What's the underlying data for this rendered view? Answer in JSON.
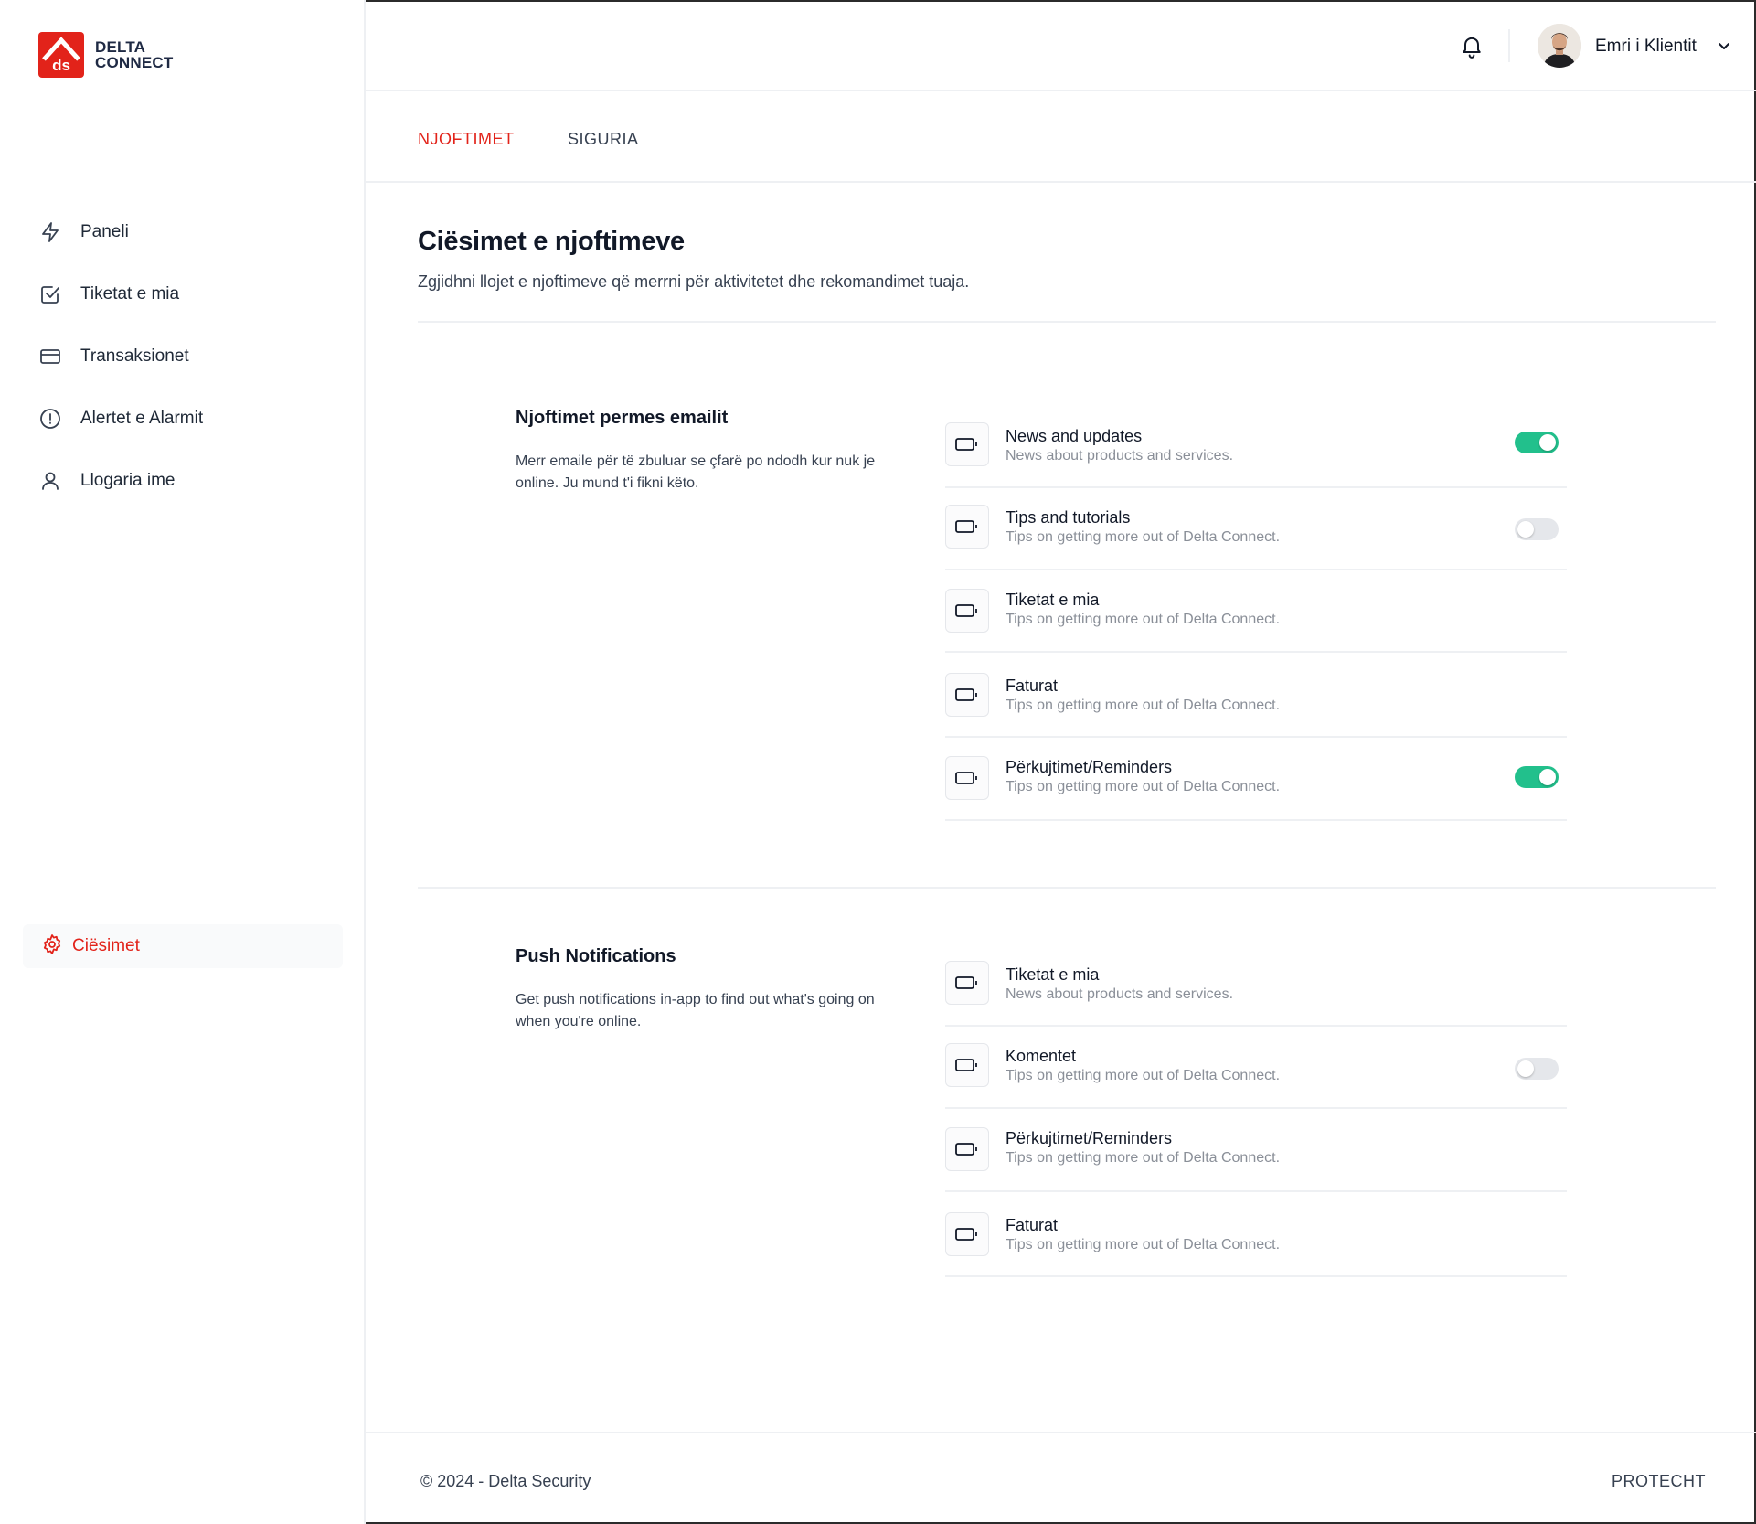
{
  "brand": {
    "line1": "DELTA",
    "line2": "CONNECT",
    "mark": "ds",
    "color": "#e2231a"
  },
  "sidebar": {
    "items": [
      {
        "label": "Paneli",
        "icon": "lightning-icon"
      },
      {
        "label": "Tiketat e mia",
        "icon": "checkbox-icon"
      },
      {
        "label": "Transaksionet",
        "icon": "credit-card-icon"
      },
      {
        "label": "Alertet e Alarmit",
        "icon": "alert-circle-icon"
      },
      {
        "label": "Llogaria ime",
        "icon": "user-icon"
      }
    ],
    "settings": {
      "label": "Ciësimet",
      "icon": "gear-icon"
    }
  },
  "header": {
    "user_name": "Emri i Klientit"
  },
  "tabs": [
    {
      "label": "NJOFTIMET",
      "active": true
    },
    {
      "label": "SIGURIA",
      "active": false
    }
  ],
  "main": {
    "title": "Ciësimet e njoftimeve",
    "subtitle": "Zgjidhni llojet e njoftimeve që merrni për aktivitetet dhe rekomandimet tuaja."
  },
  "sections": {
    "email": {
      "title": "Njoftimet permes emailit",
      "description": "Merr emaile për të zbuluar se çfarë po ndodh kur nuk je online. Ju mund t'i fikni këto.",
      "rows": [
        {
          "title": "News and updates",
          "description": "News about products and services.",
          "toggle": "on"
        },
        {
          "title": "Tips and tutorials",
          "description": "Tips on getting more out of Delta Connect.",
          "toggle": "off"
        },
        {
          "title": "Tiketat e mia",
          "description": "Tips on getting more out of Delta Connect.",
          "toggle": "none"
        },
        {
          "title": "Faturat",
          "description": "Tips on getting more out of Delta Connect.",
          "toggle": "none"
        },
        {
          "title": "Përkujtimet/Reminders",
          "description": "Tips on getting more out of Delta Connect.",
          "toggle": "on"
        }
      ]
    },
    "push": {
      "title": "Push Notifications",
      "description": "Get push notifications in-app to find out what's going on when you're online.",
      "rows": [
        {
          "title": "Tiketat e mia",
          "description": "News about products and services.",
          "toggle": "none"
        },
        {
          "title": "Komentet",
          "description": "Tips on getting more out of Delta Connect.",
          "toggle": "off"
        },
        {
          "title": "Përkujtimet/Reminders",
          "description": "Tips on getting more out of Delta Connect.",
          "toggle": "none"
        },
        {
          "title": "Faturat",
          "description": "Tips on getting more out of Delta Connect.",
          "toggle": "none"
        }
      ]
    }
  },
  "footer": {
    "copyright": "© 2024 - Delta Security",
    "brand": "PROTECHT"
  },
  "colors": {
    "accent": "#e2231a",
    "toggle_on": "#22c08c",
    "toggle_off": "#e5e7eb"
  }
}
